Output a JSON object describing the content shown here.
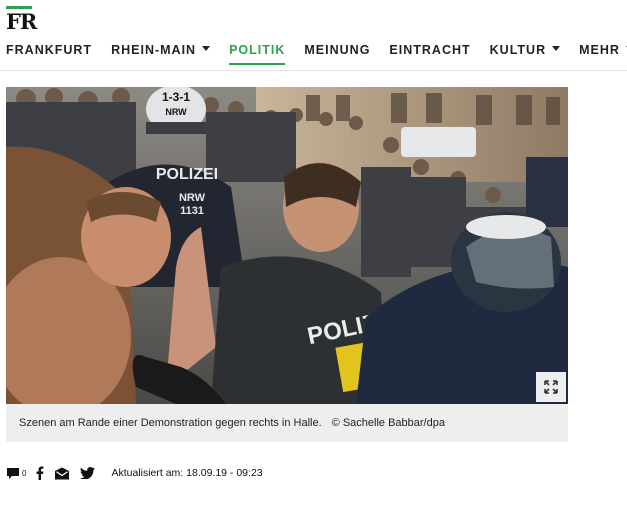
{
  "header": {
    "logo_text": "FR"
  },
  "nav": {
    "items": [
      {
        "label": "FRANKFURT"
      },
      {
        "label": "RHEIN-MAIN"
      },
      {
        "label": "POLITIK"
      },
      {
        "label": "MEINUNG"
      },
      {
        "label": "EINTRACHT"
      },
      {
        "label": "KULTUR"
      },
      {
        "label": "MEHR"
      }
    ]
  },
  "photo": {
    "helmet_number": "1-3-1",
    "helmet_state": "NRW",
    "vest_text": "POLIZEI",
    "vest_code": "NRW",
    "vest_number": "1131",
    "back_vest_text": "POLIZ"
  },
  "caption": {
    "text": "Szenen am Rande einer Demonstration gegen rechts in Halle.",
    "credit": "© Sachelle Babbar/dpa"
  },
  "share": {
    "comment_count": "0",
    "icons": [
      "comment-icon",
      "facebook-icon",
      "mail-icon",
      "twitter-icon"
    ]
  },
  "meta": {
    "updated": "Aktualisiert am: 18.09.19 - 09:23"
  },
  "colors": {
    "accent": "#2ba44d",
    "caption_bg": "#eeeeee"
  }
}
